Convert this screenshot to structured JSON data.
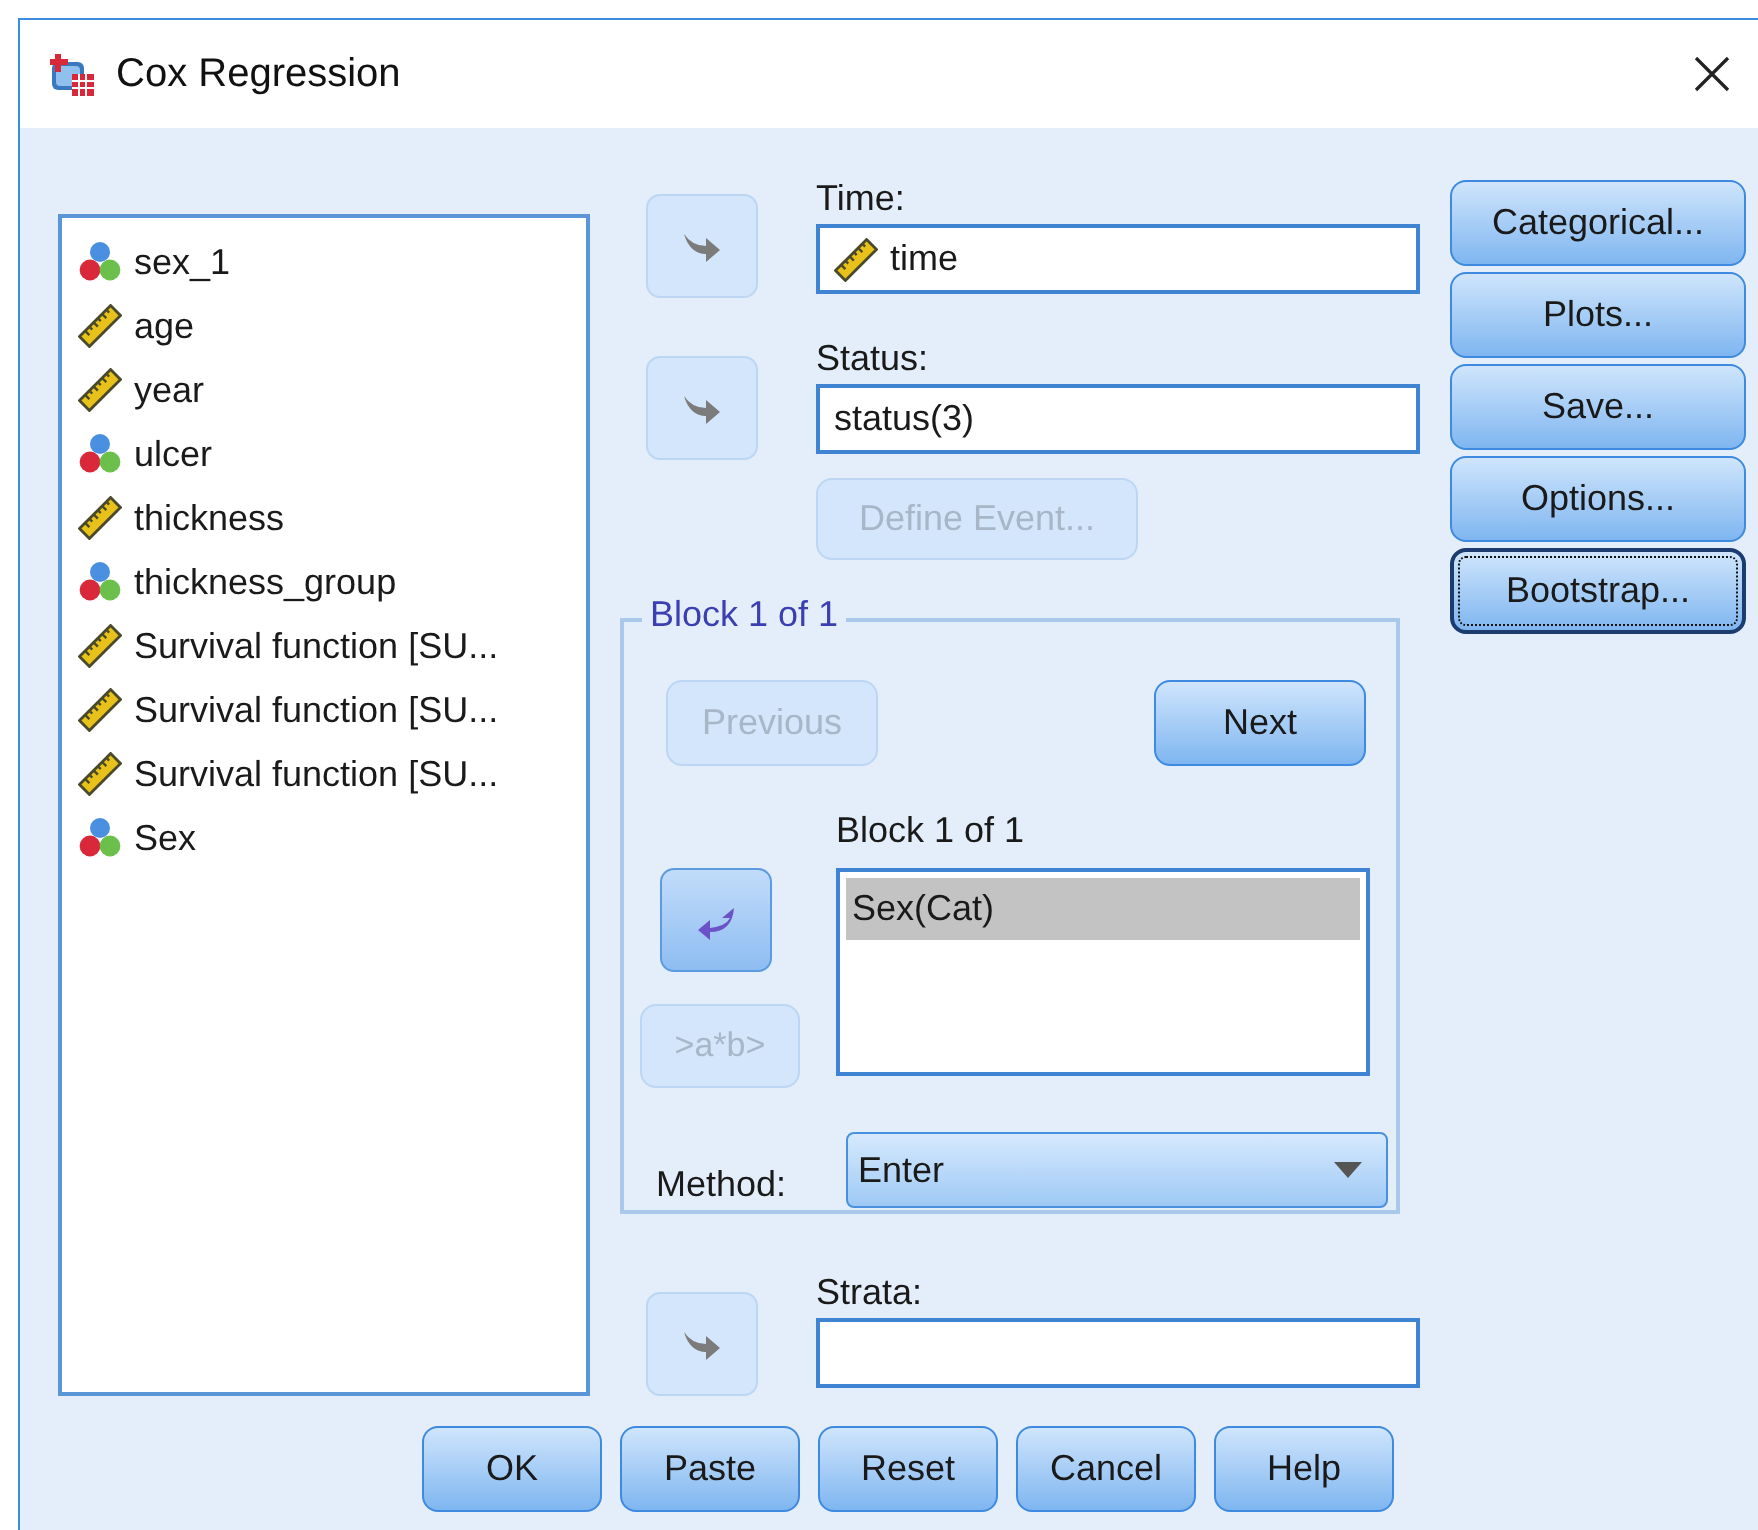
{
  "window": {
    "title": "Cox Regression"
  },
  "variables": [
    {
      "name": "sex_1",
      "kind": "nominal"
    },
    {
      "name": "age",
      "kind": "scale"
    },
    {
      "name": "year",
      "kind": "scale"
    },
    {
      "name": "ulcer",
      "kind": "nominal"
    },
    {
      "name": "thickness",
      "kind": "scale"
    },
    {
      "name": "thickness_group",
      "kind": "nominal"
    },
    {
      "name": "Survival function [SU...",
      "kind": "scale"
    },
    {
      "name": "Survival function [SU...",
      "kind": "scale"
    },
    {
      "name": "Survival function [SU...",
      "kind": "scale"
    },
    {
      "name": "Sex",
      "kind": "nominal"
    }
  ],
  "time": {
    "label": "Time:",
    "value": "time",
    "kind": "scale",
    "arrow_disabled": true
  },
  "status": {
    "label": "Status:",
    "value": "status(3)",
    "arrow_disabled": true
  },
  "define_event": {
    "label": "Define Event...",
    "disabled": true
  },
  "block": {
    "legend": "Block 1 of 1",
    "previous": {
      "label": "Previous",
      "disabled": true
    },
    "next": {
      "label": "Next",
      "disabled": false
    },
    "list_label": "Block 1 of 1",
    "items": [
      {
        "label": "Sex(Cat)",
        "selected": true
      }
    ],
    "arrow_disabled": false,
    "interaction": {
      "label": ">a*b>",
      "disabled": true
    },
    "method": {
      "label": "Method:",
      "value": "Enter"
    }
  },
  "strata": {
    "label": "Strata:",
    "arrow_disabled": true
  },
  "side_buttons": [
    {
      "label": "Categorical...",
      "focused": false
    },
    {
      "label": "Plots...",
      "focused": false
    },
    {
      "label": "Save...",
      "focused": false
    },
    {
      "label": "Options...",
      "focused": false
    },
    {
      "label": "Bootstrap...",
      "focused": true
    }
  ],
  "bottom_buttons": [
    {
      "label": "OK"
    },
    {
      "label": "Paste"
    },
    {
      "label": "Reset"
    },
    {
      "label": "Cancel"
    },
    {
      "label": "Help"
    }
  ]
}
